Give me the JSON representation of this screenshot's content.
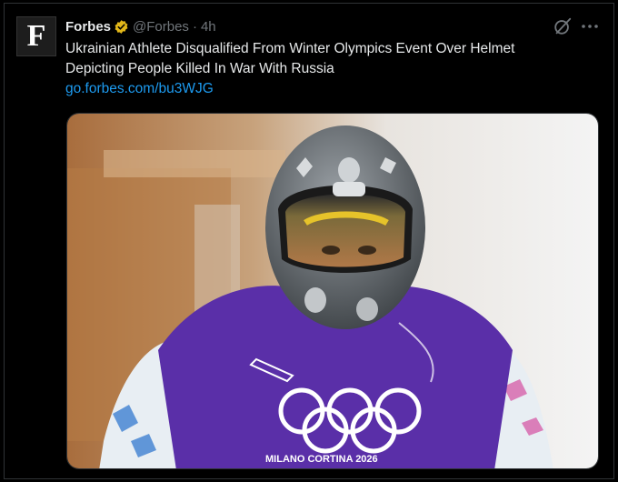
{
  "author": {
    "name": "Forbes",
    "handle": "@Forbes",
    "separator": "·",
    "time": "4h",
    "avatar_letter": "F",
    "verified_color": "#e2b719"
  },
  "tweet": {
    "text_line1": "Ukrainian Athlete Disqualified From Winter Olympics Event Over Helmet",
    "text_line2": "Depicting People Killed In War With Russia",
    "link": "go.forbes.com/bu3WJG"
  },
  "media": {
    "jersey_text": "MILANO CORTINA 2026",
    "jersey_color": "#5a2fa8",
    "icons": [
      "olympic-rings-icon",
      "skeleton-sled-icon",
      "helmet"
    ]
  },
  "icons": {
    "grok": "grok-icon",
    "more": "more-icon"
  },
  "colors": {
    "background": "#000000",
    "text": "#e7e9ea",
    "secondary": "#71767b",
    "link": "#1d9bf0"
  }
}
